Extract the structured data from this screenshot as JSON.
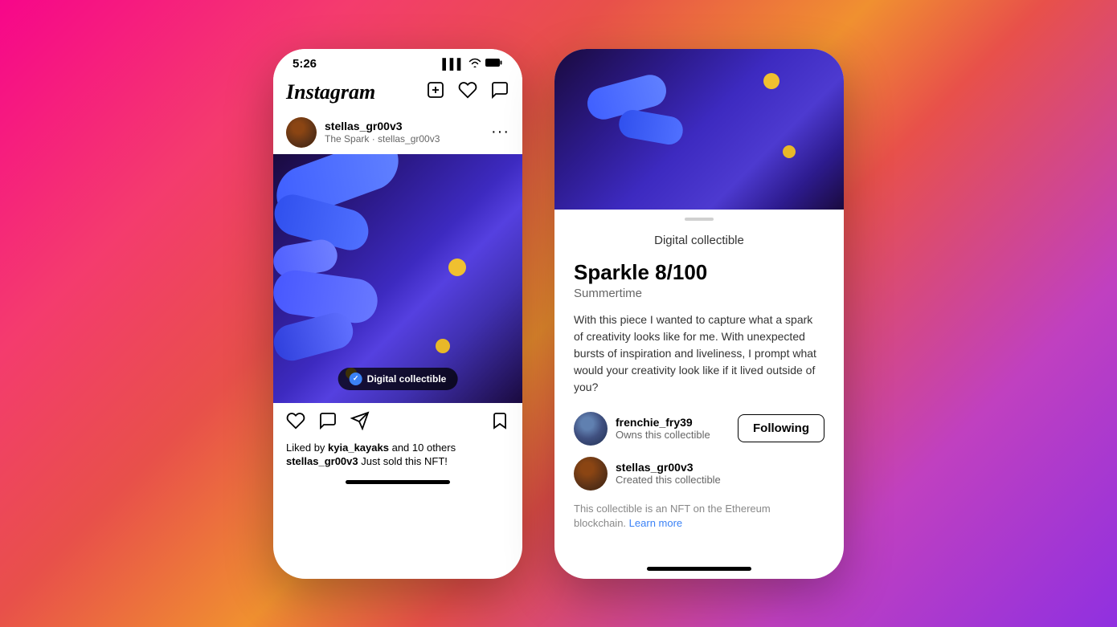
{
  "background": {
    "gradient": "pink-to-purple"
  },
  "left_phone": {
    "status_bar": {
      "time": "5:26",
      "signal": "▌▌▌",
      "wifi": "WiFi",
      "battery": "Battery"
    },
    "header": {
      "logo": "Instagram",
      "icons": [
        "plus-square",
        "heart",
        "messenger"
      ]
    },
    "post": {
      "username": "stellas_gr00v3",
      "subtitle": "The Spark · stellas_gr00v3",
      "nft_badge": "Digital collectible",
      "actions": [
        "heart",
        "comment",
        "share",
        "bookmark"
      ],
      "likes_text": "Liked by",
      "liked_by": "kyia_kayaks",
      "liked_others": "and 10 others",
      "caption_user": "stellas_gr00v3",
      "caption_text": "Just sold this NFT!"
    }
  },
  "right_phone": {
    "sheet_handle": true,
    "header_label": "Digital collectible",
    "nft_title": "Sparkle 8/100",
    "nft_collection": "Summertime",
    "nft_description": "With this piece I wanted to capture what a spark of creativity looks like for me. With unexpected bursts of inspiration and liveliness, I prompt what would your creativity look like if it lived outside of you?",
    "owner": {
      "username": "frenchie_fry39",
      "role": "Owns this collectible",
      "follow_button": "Following"
    },
    "creator": {
      "username": "stellas_gr00v3",
      "role": "Created this collectible"
    },
    "footer_text": "This collectible is an NFT on the Ethereum blockchain.",
    "learn_more": "Learn more"
  }
}
